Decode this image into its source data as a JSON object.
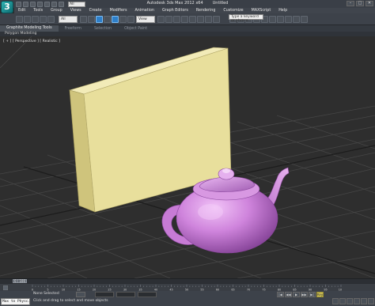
{
  "app": {
    "logo_letter": "3",
    "title": "Autodesk 3ds Max 2012 x64",
    "document": "Untitled",
    "search_placeholder": "Type a keyword or phrase"
  },
  "quick_access": {
    "workspace_value": "All"
  },
  "window_controls": {
    "minimize": "–",
    "maximize": "□",
    "close": "✕"
  },
  "menu": {
    "items": [
      "Edit",
      "Tools",
      "Group",
      "Views",
      "Create",
      "Modifiers",
      "Animation",
      "Graph Editors",
      "Rendering",
      "Customize",
      "MAXScript",
      "Help"
    ]
  },
  "toolbar": {
    "selection_filter": "All",
    "named_selection": "View"
  },
  "ribbon": {
    "tabs": [
      "Graphite Modeling Tools",
      "Freeform",
      "Selection",
      "Object Paint"
    ],
    "active_tab_index": 0,
    "panel_label": "Polygon Modeling"
  },
  "viewport": {
    "label": "[ + ] [ Perspective ] [ Realistic ]",
    "colors": {
      "box_front": "#e8df9c",
      "box_side": "#cfc47c",
      "box_top": "#f2ebb8",
      "teapot": "#cc7fd8",
      "teapot_shadow": "#8e4aa0",
      "grid": "#474747",
      "grid_axis": "#1c1c1c"
    }
  },
  "timeline": {
    "slider_label": "0 / 100",
    "ticks": [
      "0",
      "5",
      "10",
      "15",
      "20",
      "25",
      "30",
      "35",
      "40",
      "45",
      "50",
      "55",
      "60",
      "65",
      "70",
      "75",
      "80",
      "85",
      "90",
      "95",
      "100"
    ]
  },
  "status": {
    "maxscript_text": "Max to Physc.",
    "selection_status": "None Selected",
    "prompt": "Click and drag to select and move objects"
  },
  "playback": {
    "buttons": [
      "|◀",
      "◀◀",
      "▶",
      "▶▶",
      "▶|",
      "Key"
    ]
  }
}
